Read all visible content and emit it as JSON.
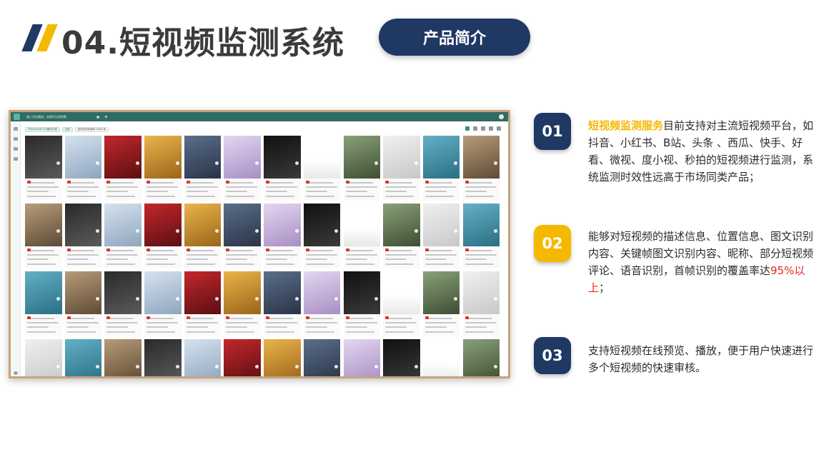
{
  "header": {
    "title": "04.短视频监测系统",
    "pill_label": "产品简介",
    "colors": {
      "navy": "#1f3864",
      "gold": "#f5b800",
      "red": "#e8261c"
    }
  },
  "screenshot": {
    "tab_label": "输入对应路由、关键字过滤参数",
    "add_tab": "+",
    "filter_chips": [
      "华为Mate60 Pro最新价格",
      "全部",
      "按时间排序最新 2096 条"
    ],
    "icons": [
      "refresh-icon",
      "download-icon",
      "filter-icon",
      "sort-icon",
      "settings-icon"
    ],
    "card_rows": 4,
    "card_columns": 12
  },
  "features": [
    {
      "number": "01",
      "highlight": "短视频监测服务",
      "text": "目前支持对主流短视频平台，如抖音、小红书、B站、头条 、西瓜、快手、好看、微视、度小视、秒拍的短视频进行监测，系统监测时效性远高于市场同类产品；"
    },
    {
      "number": "02",
      "text_before": "能够对短视频的描述信息、位置信息、图文识别内容、关键帧图文识别内容、昵称、部分短视频评论、语音识别，首帧识别的覆盖率达",
      "highlight": "95%以上",
      "text_after": "；"
    },
    {
      "number": "03",
      "text": "支持短视频在线预览、播放，便于用户快速进行多个短视频的快速审核。"
    }
  ]
}
